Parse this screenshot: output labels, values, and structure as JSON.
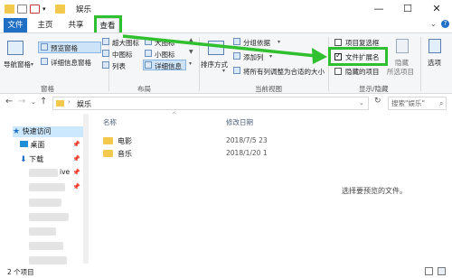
{
  "window": {
    "title": "娱乐",
    "minimize": "—",
    "maximize": "☐",
    "close": "✕"
  },
  "tabs": [
    "文件",
    "主页",
    "共享",
    "查看"
  ],
  "ribbon": {
    "pane_group": {
      "nav_pane": "导航窗格",
      "preview_pane": "预览窗格",
      "details_pane": "详细信息窗格",
      "label": "窗格"
    },
    "layout_group": {
      "items": [
        "超大图标",
        "大图标",
        "中图标",
        "小图标",
        "列表",
        "详细信息"
      ],
      "label": "布局"
    },
    "current_view_group": {
      "sort_by": "排序方式",
      "group_by": "分组依据",
      "add_columns": "添加列",
      "size_all_columns": "将所有列调整为合适的大小",
      "label": "当前视图"
    },
    "show_hide_group": {
      "item_checkboxes": "项目复选框",
      "file_extensions": "文件扩展名",
      "hidden_items": "隐藏的项目",
      "hide_selected": "隐藏",
      "hide_selected_sub": "所选项目",
      "label": "显示/隐藏"
    },
    "options": "选项"
  },
  "address": {
    "path": "娱乐",
    "search_placeholder": "搜索\"娱乐\""
  },
  "navpane": {
    "quick_access": "快速访问",
    "desktop": "桌面",
    "downloads": "下载",
    "partial_item": "ive"
  },
  "list": {
    "col_name": "名称",
    "col_modified": "修改日期",
    "rows": [
      {
        "name": "电影",
        "date": "2018/7/5 23"
      },
      {
        "name": "音乐",
        "date": "2018/1/20 1"
      }
    ]
  },
  "preview": {
    "message": "选择要预览的文件。"
  },
  "status": {
    "count": "2 个项目"
  },
  "colors": {
    "accent": "#1f6fc5",
    "highlight": "#2fbf2f",
    "folder": "#f2c94c"
  }
}
